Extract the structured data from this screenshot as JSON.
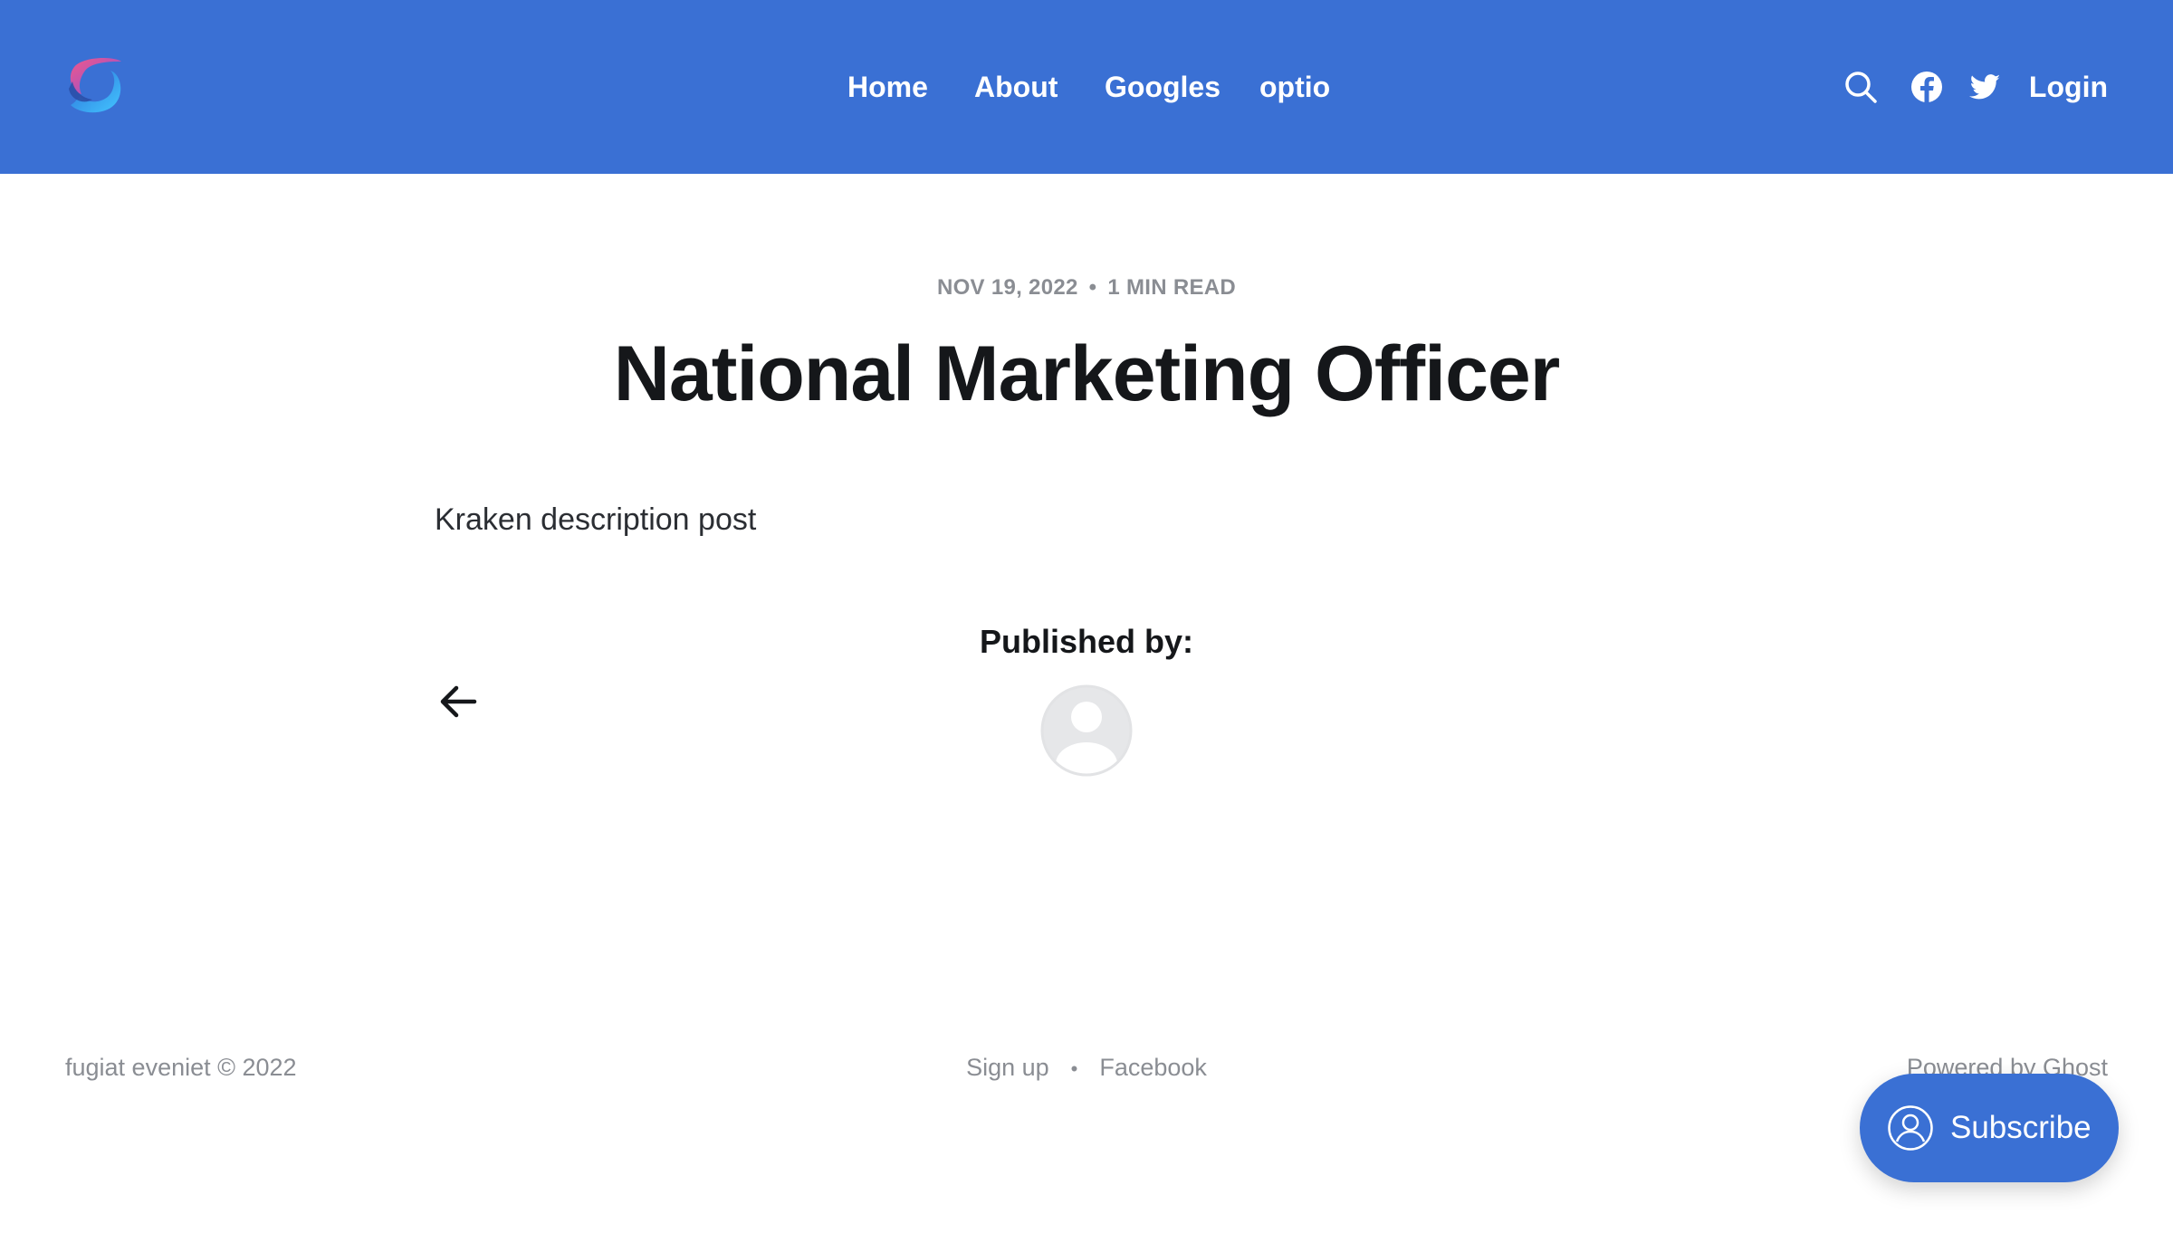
{
  "colors": {
    "brand": "#3a70d4",
    "text": "#15171a",
    "muted": "#8a8d93"
  },
  "header": {
    "nav": [
      {
        "label": "Home"
      },
      {
        "label": "About"
      },
      {
        "label": "Googles"
      },
      {
        "label": "optio"
      }
    ],
    "icons": [
      "search-icon",
      "facebook-icon",
      "twitter-icon"
    ],
    "login_label": "Login"
  },
  "article": {
    "date": "NOV 19, 2022",
    "separator": "•",
    "read_time": "1 MIN READ",
    "title": "National Marketing Officer",
    "body": "Kraken description post",
    "published_by_label": "Published by:"
  },
  "footer": {
    "copyright": "fugiat eveniet © 2022",
    "links": [
      "Sign up",
      "Facebook"
    ],
    "link_separator": "•",
    "powered_by": "Powered by Ghost"
  },
  "subscribe": {
    "label": "Subscribe"
  }
}
